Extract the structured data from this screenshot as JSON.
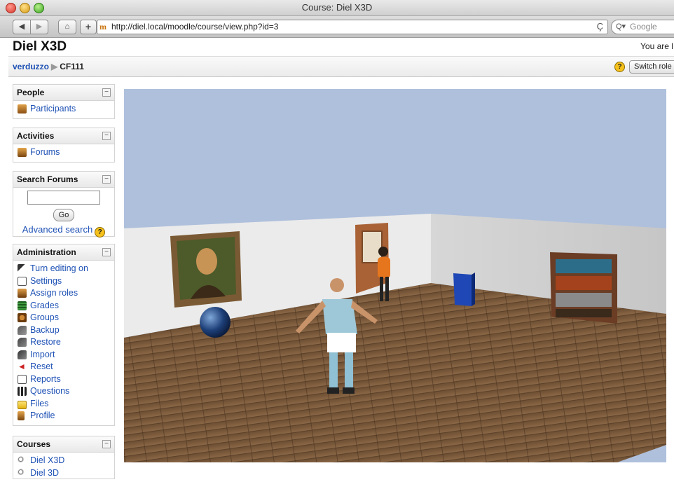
{
  "window": {
    "title": "Course: Diel X3D"
  },
  "toolbar": {
    "back": "◀",
    "forward": "▶",
    "home": "⌂",
    "add": "+",
    "url_favicon": "m",
    "url": "http://diel.local/moodle/course/view.php?id=3",
    "reload": "Ç",
    "search_glyph": "Q▾",
    "search_placeholder": "Google"
  },
  "page": {
    "site_title": "Diel X3D",
    "login_info": "You are l"
  },
  "breadcrumb": {
    "home": "verduzzo",
    "separator": "▶",
    "current": "CF111"
  },
  "navbar": {
    "help": "?",
    "switch_role": "Switch role"
  },
  "blocks": {
    "people": {
      "title": "People",
      "collapse": "−",
      "items": [
        {
          "label": "Participants",
          "icon": "participants-icon"
        }
      ]
    },
    "activities": {
      "title": "Activities",
      "collapse": "−",
      "items": [
        {
          "label": "Forums",
          "icon": "forum-icon"
        }
      ]
    },
    "search_forums": {
      "title": "Search Forums",
      "collapse": "−",
      "input_value": "",
      "go": "Go",
      "advanced": "Advanced search",
      "help": "?"
    },
    "administration": {
      "title": "Administration",
      "collapse": "−",
      "items": [
        {
          "label": "Turn editing on",
          "icon": "edit-icon"
        },
        {
          "label": "Settings",
          "icon": "settings-icon"
        },
        {
          "label": "Assign roles",
          "icon": "roles-icon"
        },
        {
          "label": "Grades",
          "icon": "grades-icon"
        },
        {
          "label": "Groups",
          "icon": "groups-icon"
        },
        {
          "label": "Backup",
          "icon": "backup-icon"
        },
        {
          "label": "Restore",
          "icon": "restore-icon"
        },
        {
          "label": "Import",
          "icon": "import-icon"
        },
        {
          "label": "Reset",
          "icon": "reset-icon"
        },
        {
          "label": "Reports",
          "icon": "reports-icon"
        },
        {
          "label": "Questions",
          "icon": "questions-icon"
        },
        {
          "label": "Files",
          "icon": "folder-icon"
        },
        {
          "label": "Profile",
          "icon": "profile-icon"
        }
      ]
    },
    "courses": {
      "title": "Courses",
      "collapse": "−",
      "items": [
        {
          "label": "Diel X3D",
          "icon": "course-icon"
        },
        {
          "label": "Diel 3D",
          "icon": "course-icon"
        }
      ]
    }
  },
  "scene": {
    "description_icons": [
      "mona-lisa-painting",
      "globe",
      "wooden-door",
      "avatar-orange",
      "avatar-soccer-player",
      "blue-book",
      "bookshelf"
    ],
    "colors": {
      "sky": "#afc0dc",
      "wall": "#ececec",
      "floor": "#7a5a3c"
    }
  }
}
